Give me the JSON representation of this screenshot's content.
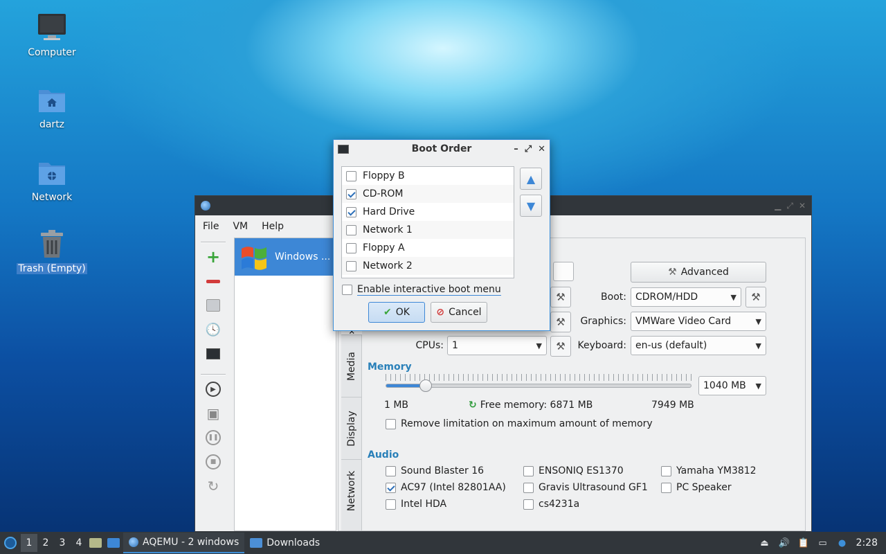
{
  "desktop": {
    "icons": [
      {
        "label": "Computer",
        "icon": "monitor-icon"
      },
      {
        "label": "dartz",
        "icon": "home-folder-icon"
      },
      {
        "label": "Network",
        "icon": "network-folder-icon"
      },
      {
        "label": "Trash (Empty)",
        "icon": "trash-icon"
      }
    ]
  },
  "main_window": {
    "menu": [
      "File",
      "VM",
      "Help"
    ],
    "vm_name": "Windows ...",
    "advanced_label": "Advanced",
    "boot_label": "Boot:",
    "boot_value": "CDROM/HDD",
    "graphics_label": "Graphics:",
    "graphics_value": "VMWare Video Card",
    "cpus_label": "CPUs:",
    "cpus_value": "1",
    "keyboard_label": "Keyboard:",
    "keyboard_value": "en-us (default)",
    "tabs": [
      "Media",
      "Display",
      "Network"
    ],
    "memory": {
      "title": "Memory",
      "value": "1040 MB",
      "min": "1 MB",
      "free": "Free memory: 6871 MB",
      "max": "7949 MB",
      "fraction": 0.13,
      "remove_limit_label": "Remove limitation on maximum amount of memory"
    },
    "audio": {
      "title": "Audio",
      "cards": [
        {
          "label": "Sound Blaster 16",
          "checked": false
        },
        {
          "label": "ENSONIQ ES1370",
          "checked": false
        },
        {
          "label": "Yamaha YM3812",
          "checked": false
        },
        {
          "label": "AC97 (Intel 82801AA)",
          "checked": true
        },
        {
          "label": "Gravis Ultrasound GF1",
          "checked": false
        },
        {
          "label": "PC Speaker",
          "checked": false
        },
        {
          "label": "Intel HDA",
          "checked": false
        },
        {
          "label": "cs4231a",
          "checked": false
        }
      ]
    }
  },
  "boot_dialog": {
    "title": "Boot Order",
    "items": [
      {
        "label": "Floppy B",
        "checked": false
      },
      {
        "label": "CD-ROM",
        "checked": true
      },
      {
        "label": "Hard Drive",
        "checked": true
      },
      {
        "label": "Network 1",
        "checked": false
      },
      {
        "label": "Floppy A",
        "checked": false
      },
      {
        "label": "Network 2",
        "checked": false
      }
    ],
    "interactive_label": "Enable interactive boot menu",
    "ok_label": "OK",
    "cancel_label": "Cancel"
  },
  "taskbar": {
    "workspaces": [
      "1",
      "2",
      "3",
      "4"
    ],
    "tasks": [
      "AQEMU - 2 windows",
      "Downloads"
    ],
    "clock": "2:28"
  },
  "colors": {
    "accent": "#3d87d6",
    "section": "#2980b9",
    "taskbar": "#31363b"
  }
}
